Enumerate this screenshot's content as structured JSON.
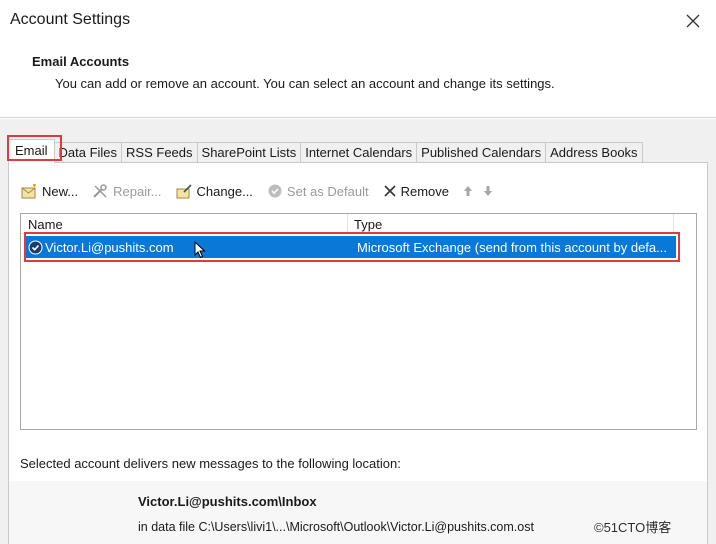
{
  "window": {
    "title": "Account Settings"
  },
  "header": {
    "title": "Email Accounts",
    "description": "You can add or remove an account. You can select an account and change its settings."
  },
  "tabs": [
    {
      "label": "Email",
      "active": true
    },
    {
      "label": "Data Files"
    },
    {
      "label": "RSS Feeds"
    },
    {
      "label": "SharePoint Lists"
    },
    {
      "label": "Internet Calendars"
    },
    {
      "label": "Published Calendars"
    },
    {
      "label": "Address Books"
    }
  ],
  "toolbar": {
    "new_label": "New...",
    "repair_label": "Repair...",
    "change_label": "Change...",
    "set_default_label": "Set as Default",
    "remove_label": "Remove"
  },
  "accounts_list": {
    "columns": [
      "Name",
      "Type"
    ],
    "rows": [
      {
        "name": "Victor.Li@pushits.com",
        "type": "Microsoft Exchange (send from this account by defa..."
      }
    ]
  },
  "delivery": {
    "text": "Selected account delivers new messages to the following location:",
    "location_name": "Victor.Li@pushits.com\\Inbox",
    "data_file": "in data file C:\\Users\\livi1\\...\\Microsoft\\Outlook\\Victor.Li@pushits.com.ost"
  },
  "watermark": "©51CTO博客",
  "colors": {
    "selection": "#0a78d7",
    "highlight": "#e0393e"
  }
}
